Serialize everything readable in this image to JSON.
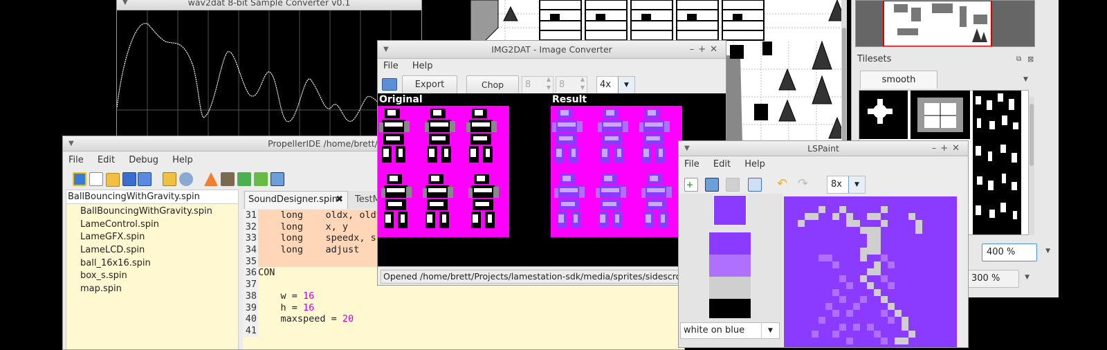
{
  "colors": {
    "magenta": "#ff00ff",
    "lilac": "#b070ff",
    "purple": "#8a3bff",
    "code_bg": "#fff8d0",
    "code_hl": "#ffd7b8",
    "number": "#d000d0"
  },
  "wav2dat": {
    "title": "wav2dat 8-bit Sample Converter v0.1"
  },
  "img2dat": {
    "title": "IMG2DAT - Image Converter",
    "menu": [
      "File",
      "Help"
    ],
    "export_label": "Export",
    "chop_label": "Chop image",
    "chop_w": "8",
    "chop_h": "8",
    "zoom": "4x",
    "original_label": "Original",
    "result_label": "Result",
    "status": "Opened /home/brett/Projects/lamestation-sdk/media/sprites/sidescroll/s"
  },
  "propide": {
    "title": "PropellerIDE /home/brett/propelleride/sdk/demos",
    "menu": [
      "File",
      "Edit",
      "Debug",
      "Help"
    ],
    "tree_root": "BallBouncingWithGravity.spin",
    "files": [
      "BallBouncingWithGravity.spin",
      "LameControl.spin",
      "LameGFX.spin",
      "LameLCD.spin",
      "ball_16x16.spin",
      "box_s.spin",
      "map.spin"
    ],
    "tabs": [
      {
        "label": "SoundDesigner.spin"
      },
      {
        "label": "TestM"
      }
    ],
    "code": [
      {
        "num": "31",
        "indent": "    ",
        "kw": "long",
        "sp": "    ",
        "text": "oldx, oldy",
        "val": ""
      },
      {
        "num": "32",
        "indent": "    ",
        "kw": "long",
        "sp": "    ",
        "text": "x, y",
        "val": ""
      },
      {
        "num": "33",
        "indent": "    ",
        "kw": "long",
        "sp": "    ",
        "text": "speedx, sp",
        "val": ""
      },
      {
        "num": "34",
        "indent": "    ",
        "kw": "long",
        "sp": "    ",
        "text": "adjust",
        "val": ""
      },
      {
        "num": "35",
        "indent": "",
        "kw": "",
        "sp": "",
        "text": "",
        "val": ""
      },
      {
        "num": "36",
        "indent": "",
        "kw": "CON",
        "sp": "",
        "text": "",
        "val": ""
      },
      {
        "num": "37",
        "indent": "",
        "kw": "",
        "sp": "",
        "text": "",
        "val": ""
      },
      {
        "num": "38",
        "indent": "    ",
        "kw": "",
        "sp": "",
        "text": "w = ",
        "val": "16"
      },
      {
        "num": "39",
        "indent": "    ",
        "kw": "",
        "sp": "",
        "text": "h = ",
        "val": "16"
      },
      {
        "num": "40",
        "indent": "    ",
        "kw": "",
        "sp": "",
        "text": "maxspeed = ",
        "val": "20"
      },
      {
        "num": "41",
        "indent": "",
        "kw": "",
        "sp": "",
        "text": "",
        "val": ""
      }
    ]
  },
  "lspaint": {
    "title": "LSPaint",
    "menu": [
      "File",
      "Edit",
      "Help"
    ],
    "zoom": "8x",
    "palette_mode": "white on blue"
  },
  "tiled": {
    "tilesets_label": "Tilesets",
    "tab_label": "smooth",
    "zoom_a": "400 %",
    "zoom_b": "300 %"
  }
}
